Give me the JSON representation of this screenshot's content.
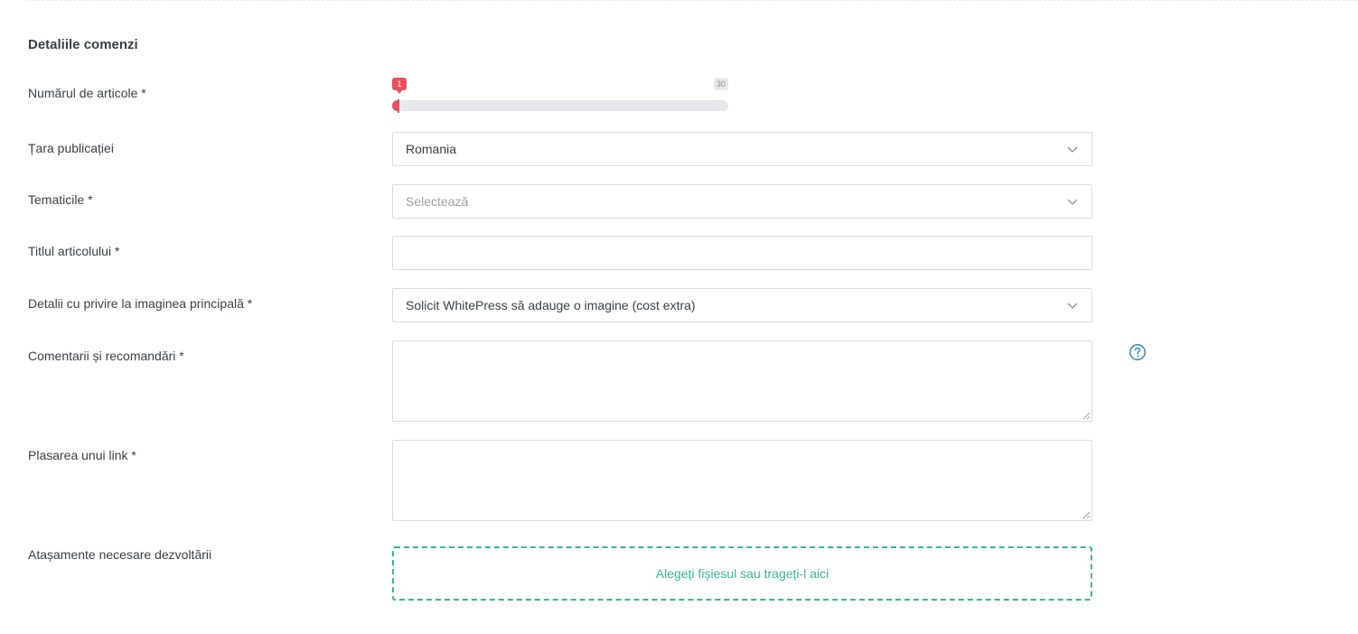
{
  "section": {
    "title": "Detaliile comenzi"
  },
  "fields": {
    "article_count": {
      "label": "Numărul de articole *",
      "min": 1,
      "max": 30,
      "value": 1,
      "min_label": "1",
      "max_label": "30"
    },
    "country": {
      "label": "Țara publicației",
      "value": "Romania"
    },
    "topics": {
      "label": "Tematicile *",
      "placeholder": "Selectează"
    },
    "article_title": {
      "label": "Titlul articolului *",
      "value": ""
    },
    "main_image": {
      "label": "Detalii cu privire la imaginea principală *",
      "value": "Solicit WhitePress să adauge o imagine (cost extra)"
    },
    "comments": {
      "label": "Comentarii și recomandări *",
      "value": ""
    },
    "link_placement": {
      "label": "Plasarea unui link *",
      "value": ""
    },
    "attachments": {
      "label": "Atașamente necesare dezvoltării",
      "dropzone_text": "Alegeți fișiesul sau trageți-l aici"
    }
  },
  "icons": {
    "help": "question-circle-icon",
    "chevron": "chevron-down-icon"
  },
  "colors": {
    "accent_red": "#e8505b",
    "accent_green": "#35b69a",
    "help_blue": "#3d8fd1",
    "track_gray": "#e6e8eb"
  }
}
